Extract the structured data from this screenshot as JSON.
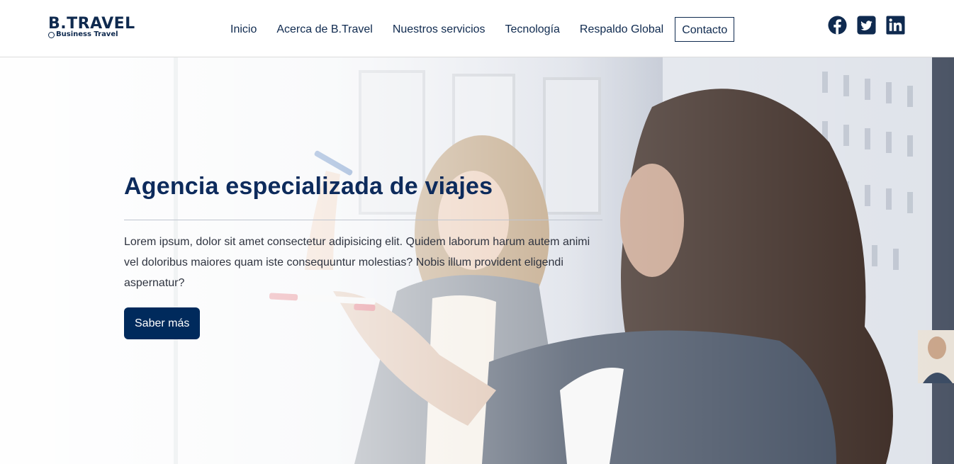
{
  "brand": {
    "name": "B.TRAVEL",
    "tagline": "Business Travel"
  },
  "nav": {
    "items": [
      {
        "label": "Inicio"
      },
      {
        "label": "Acerca de B.Travel"
      },
      {
        "label": "Nuestros servicios"
      },
      {
        "label": "Tecnología"
      },
      {
        "label": "Respaldo Global"
      },
      {
        "label": "Contacto"
      }
    ]
  },
  "social": {
    "icons": [
      "facebook-icon",
      "twitter-icon",
      "linkedin-icon"
    ],
    "color": "#0f2a4f"
  },
  "hero": {
    "title": "Agencia especializada de viajes",
    "text": "Lorem ipsum, dolor sit amet consectetur adipisicing elit. Quidem laborum harum autem animi vel doloribus maiores quam iste consequuntur molestias? Nobis illum provident eligendi aspernatur?",
    "button_label": "Saber más",
    "accent_color": "#002a5c"
  }
}
